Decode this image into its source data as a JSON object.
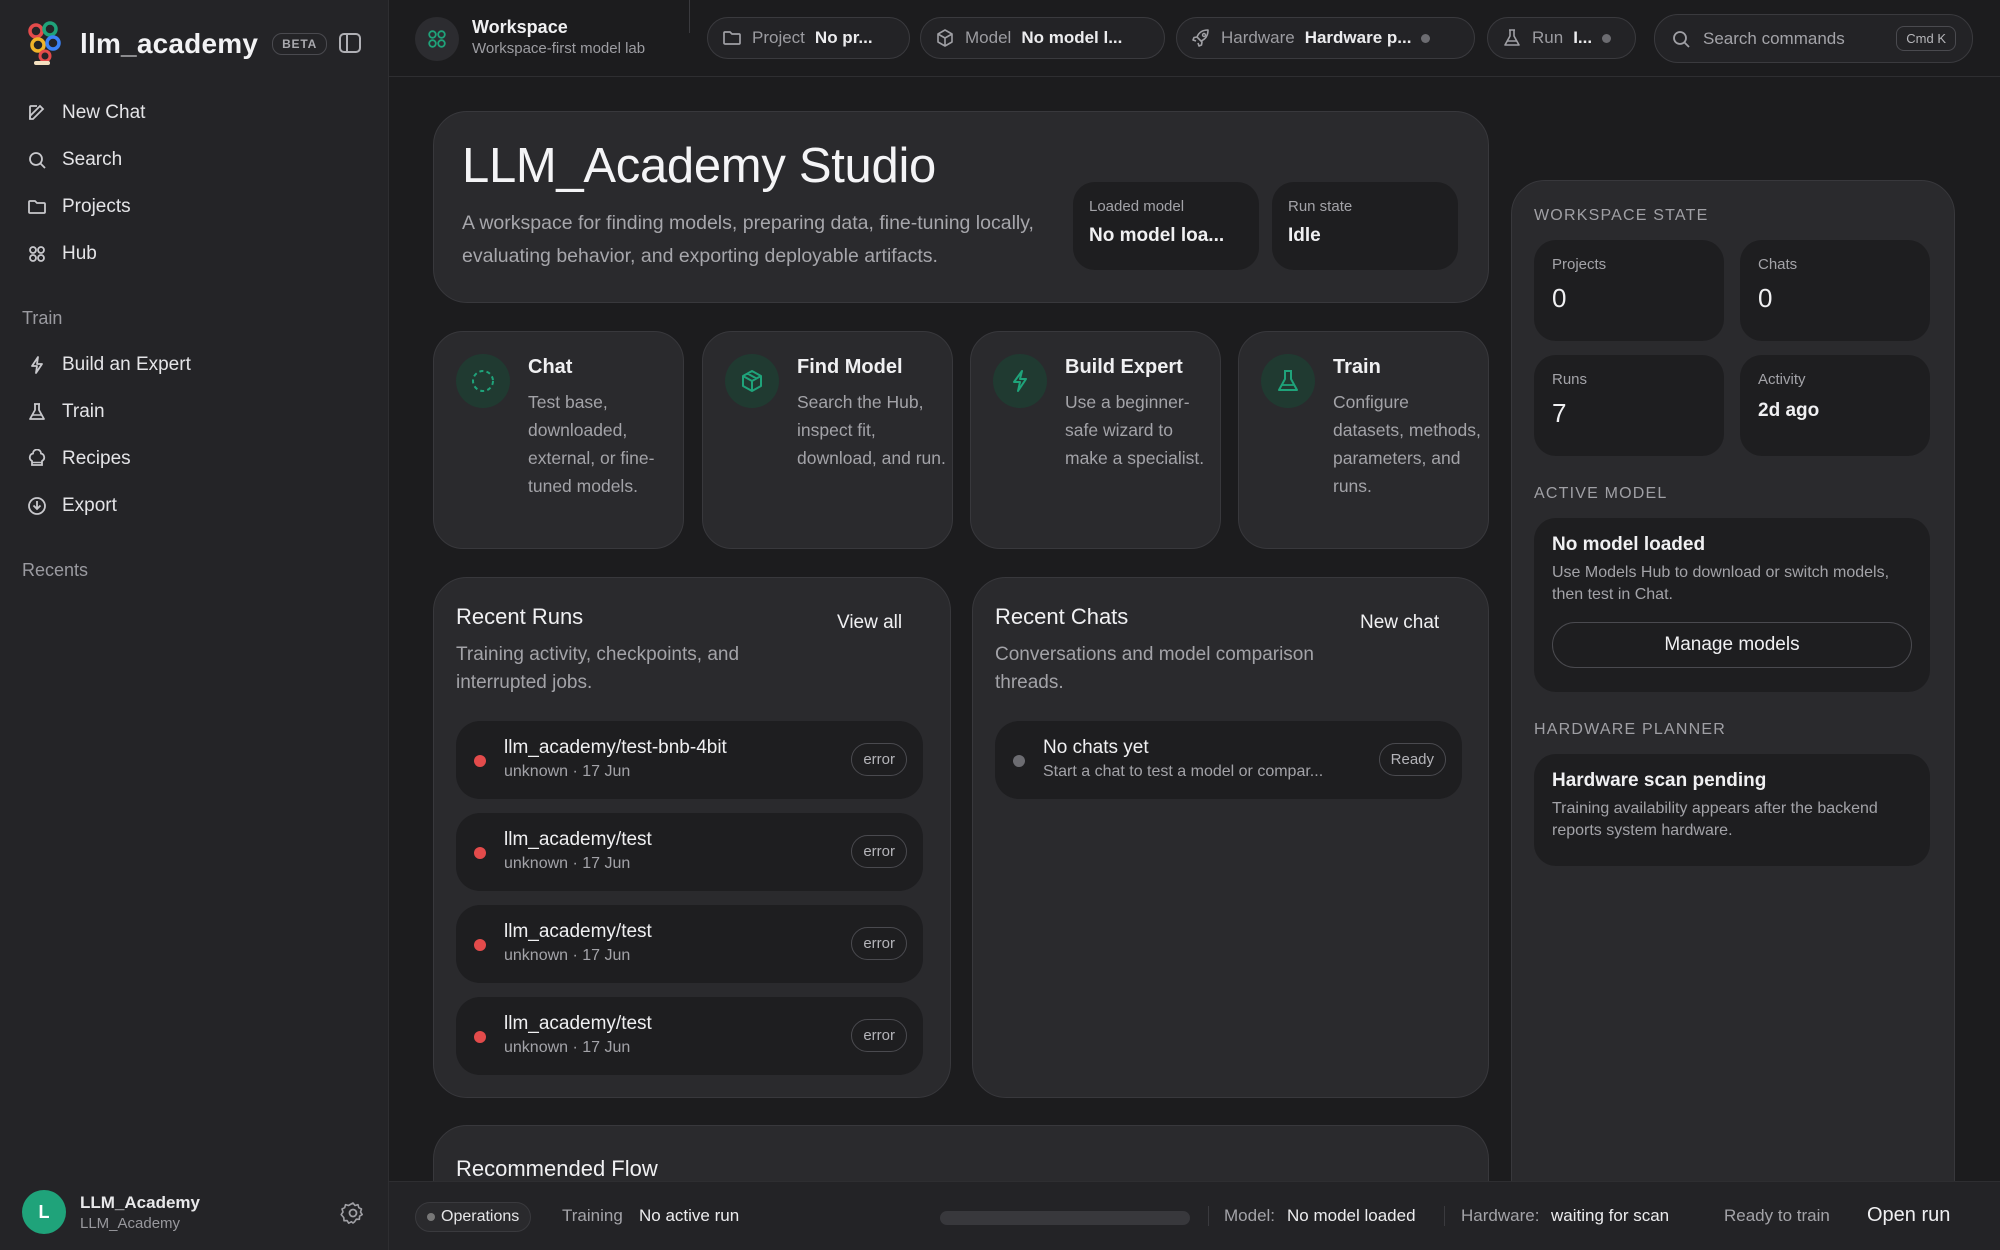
{
  "app": {
    "name": "llm_academy",
    "badge": "BETA"
  },
  "sidebar": {
    "primary": [
      {
        "label": "New Chat",
        "icon": "edit-icon"
      },
      {
        "label": "Search",
        "icon": "search-icon"
      },
      {
        "label": "Projects",
        "icon": "folder-icon"
      },
      {
        "label": "Hub",
        "icon": "grid-icon"
      }
    ],
    "train_section": "Train",
    "train": [
      {
        "label": "Build an Expert",
        "icon": "lightning-icon"
      },
      {
        "label": "Train",
        "icon": "flask-icon"
      },
      {
        "label": "Recipes",
        "icon": "chef-hat-icon"
      },
      {
        "label": "Export",
        "icon": "download-icon"
      }
    ],
    "recents_section": "Recents",
    "user": {
      "initial": "L",
      "name": "LLM_Academy",
      "sub": "LLM_Academy"
    }
  },
  "topbar": {
    "workspace_title": "Workspace",
    "workspace_sub": "Workspace-first model lab",
    "pills": [
      {
        "label": "Project",
        "value": "No pr..."
      },
      {
        "label": "Model",
        "value": "No model l..."
      },
      {
        "label": "Hardware",
        "value": "Hardware p..."
      },
      {
        "label": "Run",
        "value": "I..."
      }
    ],
    "search": {
      "placeholder": "Search commands",
      "shortcut": "Cmd K"
    }
  },
  "hero": {
    "title": "LLM_Academy Studio",
    "description": "A workspace for finding models, preparing data, fine-tuning locally, evaluating behavior, and exporting deployable artifacts.",
    "loaded_model_label": "Loaded model",
    "loaded_model_value": "No model loa...",
    "run_state_label": "Run state",
    "run_state_value": "Idle"
  },
  "features": [
    {
      "title": "Chat",
      "desc": "Test base, downloaded, external, or fine-tuned models.",
      "icon": "dashed-circle-icon"
    },
    {
      "title": "Find Model",
      "desc": "Search the Hub, inspect fit, download, and run.",
      "icon": "cube-icon"
    },
    {
      "title": "Build Expert",
      "desc": "Use a beginner-safe wizard to make a specialist.",
      "icon": "lightning-icon"
    },
    {
      "title": "Train",
      "desc": "Configure datasets, methods, parameters, and runs.",
      "icon": "flask-icon"
    }
  ],
  "recent_runs": {
    "title": "Recent Runs",
    "link": "View all",
    "description": "Training activity, checkpoints, and interrupted jobs.",
    "rows": [
      {
        "title": "llm_academy/test-bnb-4bit",
        "sub": "unknown · 17 Jun",
        "status": "error"
      },
      {
        "title": "llm_academy/test",
        "sub": "unknown · 17 Jun",
        "status": "error"
      },
      {
        "title": "llm_academy/test",
        "sub": "unknown · 17 Jun",
        "status": "error"
      },
      {
        "title": "llm_academy/test",
        "sub": "unknown · 17 Jun",
        "status": "error"
      }
    ]
  },
  "recent_chats": {
    "title": "Recent Chats",
    "link": "New chat",
    "description": "Conversations and model comparison threads.",
    "rows": [
      {
        "title": "No chats yet",
        "sub": "Start a chat to test a model or compar...",
        "status": "Ready"
      }
    ]
  },
  "recommended_flow": {
    "title": "Recommended Flow"
  },
  "workspace_state": {
    "label": "WORKSPACE STATE",
    "projects_label": "Projects",
    "projects_value": "0",
    "chats_label": "Chats",
    "chats_value": "0",
    "runs_label": "Runs",
    "runs_value": "7",
    "activity_label": "Activity",
    "activity_value": "2d ago"
  },
  "active_model": {
    "label": "ACTIVE MODEL",
    "title": "No model loaded",
    "description": "Use Models Hub to download or switch models, then test in Chat.",
    "button": "Manage models"
  },
  "hardware_planner": {
    "label": "HARDWARE PLANNER",
    "title": "Hardware scan pending",
    "description": "Training availability appears after the backend reports system hardware."
  },
  "bottombar": {
    "ops": "Operations",
    "training_label": "Training",
    "training_value": "No active run",
    "progress_fraction": 0,
    "model_label": "Model:",
    "model_value": "No model loaded",
    "hardware_label": "Hardware:",
    "hardware_value": "waiting for scan",
    "ready": "Ready to train",
    "open_run": "Open run"
  },
  "colors": {
    "accent": "#1fa37a",
    "error": "#e34b4b",
    "background": "#1c1c1e",
    "card": "#2a2a2d"
  }
}
